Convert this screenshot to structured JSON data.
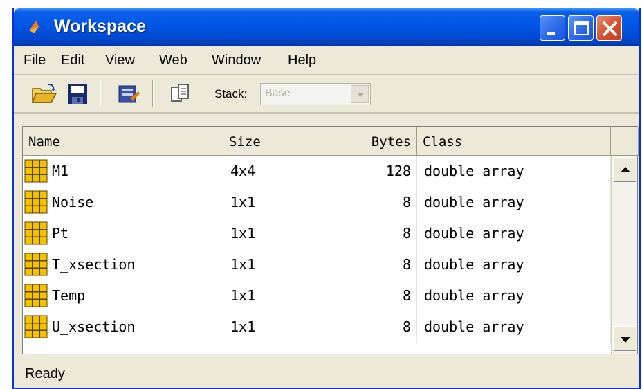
{
  "window": {
    "title": "Workspace"
  },
  "menu": {
    "items": [
      "File",
      "Edit",
      "View",
      "Web",
      "Window",
      "Help"
    ]
  },
  "toolbar": {
    "buttons": [
      "open-folder-icon",
      "save-icon",
      "import-data-icon",
      "copy-icon"
    ],
    "stack_label": "Stack:",
    "stack_value": "Base"
  },
  "table": {
    "columns": [
      "Name",
      "Size",
      "Bytes",
      "Class"
    ],
    "rows": [
      {
        "name": "M1",
        "size": "4x4",
        "bytes": "128",
        "class": "double array"
      },
      {
        "name": "Noise",
        "size": "1x1",
        "bytes": "8",
        "class": "double array"
      },
      {
        "name": "Pt",
        "size": "1x1",
        "bytes": "8",
        "class": "double array"
      },
      {
        "name": "T_xsection",
        "size": "1x1",
        "bytes": "8",
        "class": "double array"
      },
      {
        "name": "Temp",
        "size": "1x1",
        "bytes": "8",
        "class": "double array"
      },
      {
        "name": "U_xsection",
        "size": "1x1",
        "bytes": "8",
        "class": "double array"
      }
    ]
  },
  "status": {
    "text": "Ready"
  },
  "colors": {
    "titlebar": "#0055e5",
    "window_bg": "#ece9d8",
    "close_button": "#d7502d",
    "variable_icon": "#f2c200"
  }
}
